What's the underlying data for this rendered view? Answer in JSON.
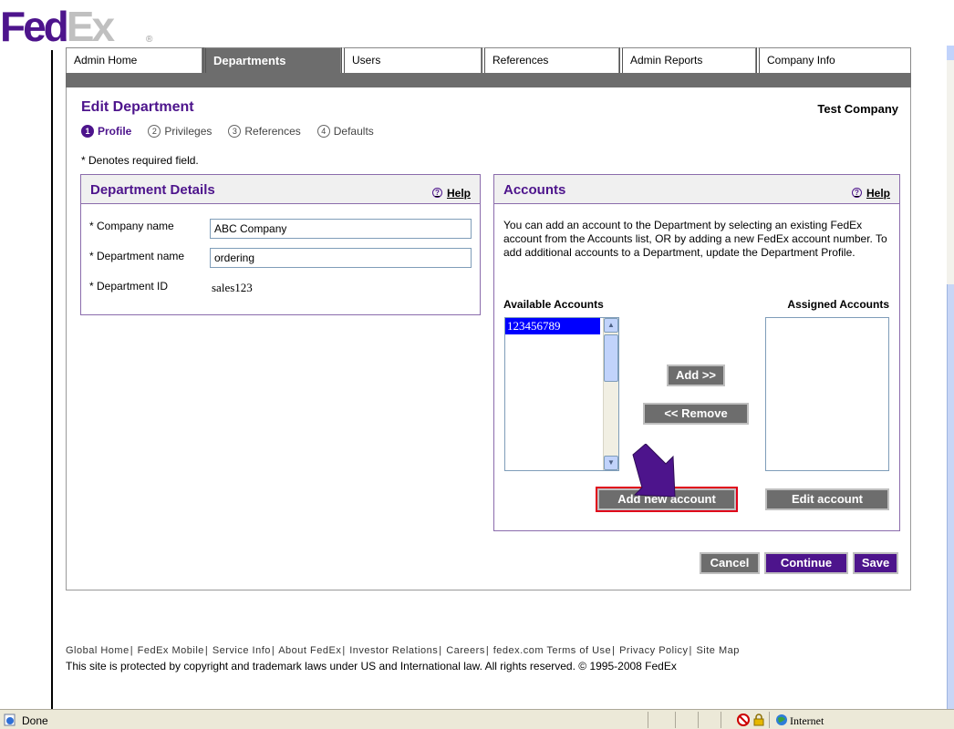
{
  "logo": {
    "fed": "Fed",
    "ex": "Ex",
    "reg": "®"
  },
  "tabs": [
    {
      "label": "Admin Home"
    },
    {
      "label": "Departments"
    },
    {
      "label": "Users"
    },
    {
      "label": "References"
    },
    {
      "label": "Admin Reports"
    },
    {
      "label": "Company Info"
    }
  ],
  "active_tab": "Departments",
  "page": {
    "title": "Edit Department",
    "company": "Test Company",
    "required_note": "* Denotes required field."
  },
  "steps": [
    {
      "num": "1",
      "label": "Profile",
      "active": true
    },
    {
      "num": "2",
      "label": "Privileges"
    },
    {
      "num": "3",
      "label": "References"
    },
    {
      "num": "4",
      "label": "Defaults"
    }
  ],
  "department_details": {
    "title": "Department Details",
    "help": "Help",
    "company_name_label": "* Company name",
    "company_name_value": "ABC Company",
    "department_name_label": "* Department name",
    "department_name_value": "ordering",
    "department_id_label": "* Department ID",
    "department_id_value": "sales123"
  },
  "accounts": {
    "title": "Accounts",
    "help": "Help",
    "description": "You can add an account to the Department by selecting an existing FedEx account from the Accounts list, OR by adding a new FedEx account number. To add additional accounts to a Department, update the Department Profile.",
    "available_label": "Available Accounts",
    "assigned_label": "Assigned Accounts",
    "available_items": [
      "123456789"
    ],
    "assigned_items": [],
    "add_button": "Add >>",
    "remove_button": "<< Remove",
    "add_new_button": "Add new account",
    "edit_button": "Edit account"
  },
  "actions": {
    "cancel": "Cancel",
    "continue": "Continue",
    "save": "Save"
  },
  "footer": {
    "links": [
      "Global Home",
      "FedEx Mobile",
      "Service Info",
      "About FedEx",
      "Investor Relations",
      "Careers",
      "fedex.com Terms of Use",
      "Privacy Policy",
      "Site Map"
    ],
    "copyright": "This site is protected by copyright and trademark laws under US and International law. All rights reserved. © 1995-2008 FedEx"
  },
  "statusbar": {
    "status": "Done",
    "zone": "Internet"
  },
  "colors": {
    "brand_purple": "#4d148c",
    "tab_gray": "#6d6d6d",
    "highlight_red": "#e0001a"
  }
}
